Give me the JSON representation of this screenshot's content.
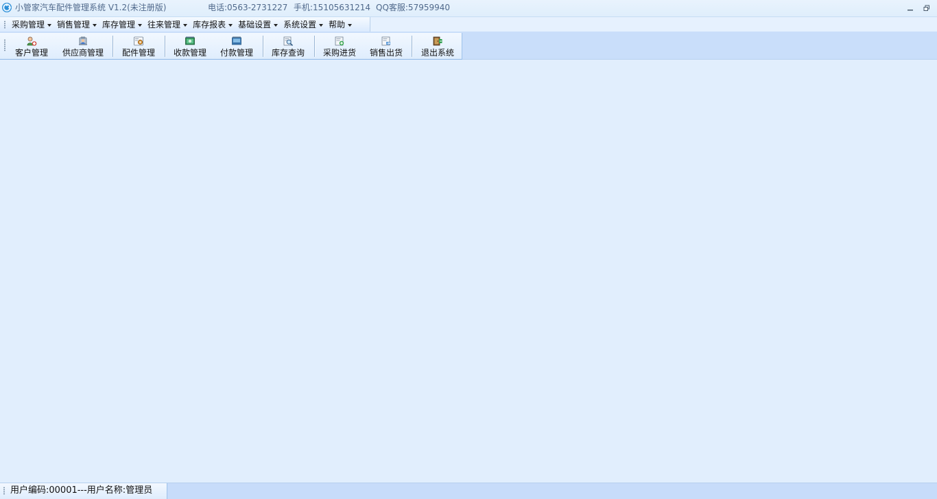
{
  "window": {
    "title": "小管家汽车配件管理系统 V1.2(未注册版)",
    "phone": "电话:0563-2731227",
    "mobile": "手机:15105631214",
    "qq": "QQ客服:57959940"
  },
  "window_controls": {
    "icons": [
      "minimize-icon",
      "restore-icon"
    ]
  },
  "menu": {
    "items": [
      {
        "label": "采购管理"
      },
      {
        "label": "销售管理"
      },
      {
        "label": "库存管理"
      },
      {
        "label": "往来管理"
      },
      {
        "label": "库存报表"
      },
      {
        "label": "基础设置"
      },
      {
        "label": "系统设置"
      },
      {
        "label": "帮助"
      }
    ]
  },
  "toolbar": {
    "buttons": [
      {
        "label": "客户管理",
        "icon": "customer-icon"
      },
      {
        "label": "供应商管理",
        "icon": "supplier-icon"
      },
      {
        "label": "配件管理",
        "icon": "parts-icon"
      },
      {
        "label": "收款管理",
        "icon": "receipt-icon"
      },
      {
        "label": "付款管理",
        "icon": "payment-icon"
      },
      {
        "label": "库存查询",
        "icon": "inventory-search-icon"
      },
      {
        "label": "采购进货",
        "icon": "purchase-inbound-icon"
      },
      {
        "label": "销售出货",
        "icon": "sales-outbound-icon"
      },
      {
        "label": "退出系统",
        "icon": "exit-icon"
      }
    ]
  },
  "status": {
    "text": "用户编码:00001---用户名称:管理员"
  },
  "colors": {
    "workspace": "#e1eefd",
    "toolbar_band": "#c9defa",
    "strip_border": "#9ec2ea",
    "title_text": "#50698b"
  }
}
